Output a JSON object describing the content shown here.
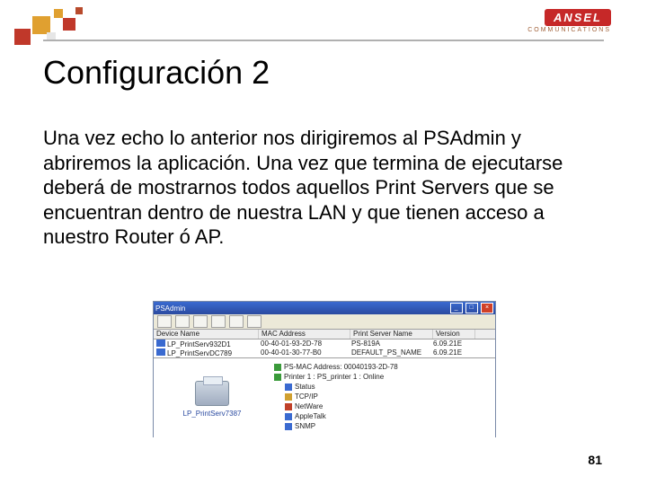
{
  "brand": {
    "name": "ANSEL",
    "sub": "COMMUNICATIONS"
  },
  "title": "Configuración 2",
  "body": "Una vez echo lo anterior nos dirigiremos al PSAdmin y abriremos la aplicación.  Una vez que termina de ejecutarse deberá de mostrarnos todos aquellos Print Servers que se encuentran dentro de nuestra LAN y que tienen acceso a nuestro Router ó AP.",
  "page_number": "81",
  "psadmin": {
    "window_title": "PSAdmin",
    "columns": {
      "c1": "Device Name",
      "c2": "MAC Address",
      "c3": "Print Server Name",
      "c4": "Version"
    },
    "rows": [
      {
        "c1": "LP_PrintServ932D1",
        "c2": "00-40-01-93-2D-78",
        "c3": "PS-819A",
        "c4": "6.09.21E"
      },
      {
        "c1": "LP_PrintServDC789",
        "c2": "00-40-01-30-77-B0",
        "c3": "DEFAULT_PS_NAME",
        "c4": "6.09.21E"
      }
    ],
    "detail_label": "LP_PrintServ7387",
    "tree": [
      "PS-MAC Address: 00040193-2D-78",
      "Printer 1 : PS_printer 1 : Online",
      "Status",
      "TCP/IP",
      "NetWare",
      "AppleTalk",
      "SNMP"
    ]
  }
}
